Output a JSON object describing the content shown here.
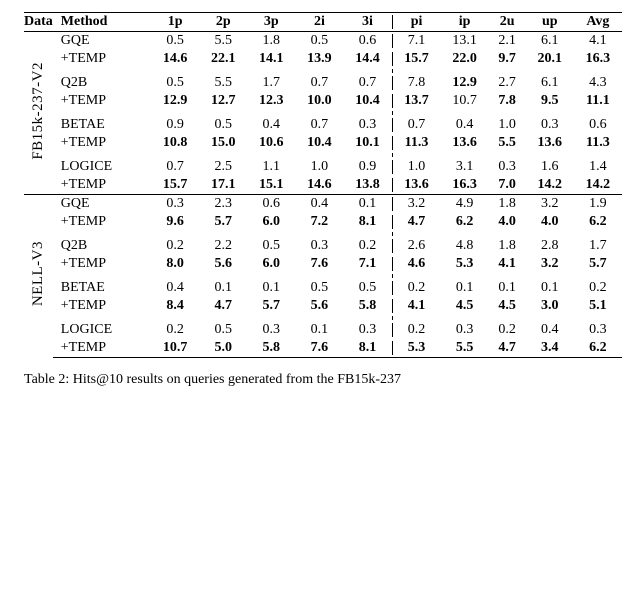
{
  "header": {
    "data": "Data",
    "method": "Method",
    "cols": [
      "1p",
      "2p",
      "3p",
      "2i",
      "3i",
      "pi",
      "ip",
      "2u",
      "up",
      "Avg"
    ]
  },
  "chart_data": {
    "type": "table",
    "title": "Hits@10 results comparison",
    "col_groups": [
      "left",
      "left",
      "left",
      "left",
      "left",
      "right",
      "right",
      "right",
      "right",
      "right"
    ],
    "datasets": [
      {
        "name": "FB15k-237-V2",
        "groups": [
          {
            "rows": [
              {
                "method": "GQE",
                "vals": [
                  "0.5",
                  "5.5",
                  "1.8",
                  "0.5",
                  "0.6",
                  "7.1",
                  "13.1",
                  "2.1",
                  "6.1",
                  "4.1"
                ],
                "bold_mask": [
                  0,
                  0,
                  0,
                  0,
                  0,
                  0,
                  0,
                  0,
                  0,
                  0
                ]
              },
              {
                "method": "+TEMP",
                "vals": [
                  "14.6",
                  "22.1",
                  "14.1",
                  "13.9",
                  "14.4",
                  "15.7",
                  "22.0",
                  "9.7",
                  "20.1",
                  "16.3"
                ],
                "bold_mask": [
                  1,
                  1,
                  1,
                  1,
                  1,
                  1,
                  1,
                  1,
                  1,
                  1
                ]
              }
            ]
          },
          {
            "rows": [
              {
                "method": "Q2B",
                "vals": [
                  "0.5",
                  "5.5",
                  "1.7",
                  "0.7",
                  "0.7",
                  "7.8",
                  "12.9",
                  "2.7",
                  "6.1",
                  "4.3"
                ],
                "bold_mask": [
                  0,
                  0,
                  0,
                  0,
                  0,
                  0,
                  1,
                  0,
                  0,
                  0
                ]
              },
              {
                "method": "+TEMP",
                "vals": [
                  "12.9",
                  "12.7",
                  "12.3",
                  "10.0",
                  "10.4",
                  "13.7",
                  "10.7",
                  "7.8",
                  "9.5",
                  "11.1"
                ],
                "bold_mask": [
                  1,
                  1,
                  1,
                  1,
                  1,
                  1,
                  0,
                  1,
                  1,
                  1
                ]
              }
            ]
          },
          {
            "rows": [
              {
                "method": "BETAE",
                "vals": [
                  "0.9",
                  "0.5",
                  "0.4",
                  "0.7",
                  "0.3",
                  "0.7",
                  "0.4",
                  "1.0",
                  "0.3",
                  "0.6"
                ],
                "bold_mask": [
                  0,
                  0,
                  0,
                  0,
                  0,
                  0,
                  0,
                  0,
                  0,
                  0
                ]
              },
              {
                "method": "+TEMP",
                "vals": [
                  "10.8",
                  "15.0",
                  "10.6",
                  "10.4",
                  "10.1",
                  "11.3",
                  "13.6",
                  "5.5",
                  "13.6",
                  "11.3"
                ],
                "bold_mask": [
                  1,
                  1,
                  1,
                  1,
                  1,
                  1,
                  1,
                  1,
                  1,
                  1
                ]
              }
            ]
          },
          {
            "rows": [
              {
                "method": "LOGICE",
                "vals": [
                  "0.7",
                  "2.5",
                  "1.1",
                  "1.0",
                  "0.9",
                  "1.0",
                  "3.1",
                  "0.3",
                  "1.6",
                  "1.4"
                ],
                "bold_mask": [
                  0,
                  0,
                  0,
                  0,
                  0,
                  0,
                  0,
                  0,
                  0,
                  0
                ]
              },
              {
                "method": "+TEMP",
                "vals": [
                  "15.7",
                  "17.1",
                  "15.1",
                  "14.6",
                  "13.8",
                  "13.6",
                  "16.3",
                  "7.0",
                  "14.2",
                  "14.2"
                ],
                "bold_mask": [
                  1,
                  1,
                  1,
                  1,
                  1,
                  1,
                  1,
                  1,
                  1,
                  1
                ]
              }
            ]
          }
        ]
      },
      {
        "name": "NELL-V3",
        "groups": [
          {
            "rows": [
              {
                "method": "GQE",
                "vals": [
                  "0.3",
                  "2.3",
                  "0.6",
                  "0.4",
                  "0.1",
                  "3.2",
                  "4.9",
                  "1.8",
                  "3.2",
                  "1.9"
                ],
                "bold_mask": [
                  0,
                  0,
                  0,
                  0,
                  0,
                  0,
                  0,
                  0,
                  0,
                  0
                ]
              },
              {
                "method": "+TEMP",
                "vals": [
                  "9.6",
                  "5.7",
                  "6.0",
                  "7.2",
                  "8.1",
                  "4.7",
                  "6.2",
                  "4.0",
                  "4.0",
                  "6.2"
                ],
                "bold_mask": [
                  1,
                  1,
                  1,
                  1,
                  1,
                  1,
                  1,
                  1,
                  1,
                  1
                ]
              }
            ]
          },
          {
            "rows": [
              {
                "method": "Q2B",
                "vals": [
                  "0.2",
                  "2.2",
                  "0.5",
                  "0.3",
                  "0.2",
                  "2.6",
                  "4.8",
                  "1.8",
                  "2.8",
                  "1.7"
                ],
                "bold_mask": [
                  0,
                  0,
                  0,
                  0,
                  0,
                  0,
                  0,
                  0,
                  0,
                  0
                ]
              },
              {
                "method": "+TEMP",
                "vals": [
                  "8.0",
                  "5.6",
                  "6.0",
                  "7.6",
                  "7.1",
                  "4.6",
                  "5.3",
                  "4.1",
                  "3.2",
                  "5.7"
                ],
                "bold_mask": [
                  1,
                  1,
                  1,
                  1,
                  1,
                  1,
                  1,
                  1,
                  1,
                  1
                ]
              }
            ]
          },
          {
            "rows": [
              {
                "method": "BETAE",
                "vals": [
                  "0.4",
                  "0.1",
                  "0.1",
                  "0.5",
                  "0.5",
                  "0.2",
                  "0.1",
                  "0.1",
                  "0.1",
                  "0.2"
                ],
                "bold_mask": [
                  0,
                  0,
                  0,
                  0,
                  0,
                  0,
                  0,
                  0,
                  0,
                  0
                ]
              },
              {
                "method": "+TEMP",
                "vals": [
                  "8.4",
                  "4.7",
                  "5.7",
                  "5.6",
                  "5.8",
                  "4.1",
                  "4.5",
                  "4.5",
                  "3.0",
                  "5.1"
                ],
                "bold_mask": [
                  1,
                  1,
                  1,
                  1,
                  1,
                  1,
                  1,
                  1,
                  1,
                  1
                ]
              }
            ]
          },
          {
            "rows": [
              {
                "method": "LOGICE",
                "vals": [
                  "0.2",
                  "0.5",
                  "0.3",
                  "0.1",
                  "0.3",
                  "0.2",
                  "0.3",
                  "0.2",
                  "0.4",
                  "0.3"
                ],
                "bold_mask": [
                  0,
                  0,
                  0,
                  0,
                  0,
                  0,
                  0,
                  0,
                  0,
                  0
                ]
              },
              {
                "method": "+TEMP",
                "vals": [
                  "10.7",
                  "5.0",
                  "5.8",
                  "7.6",
                  "8.1",
                  "5.3",
                  "5.5",
                  "4.7",
                  "3.4",
                  "6.2"
                ],
                "bold_mask": [
                  1,
                  1,
                  1,
                  1,
                  1,
                  1,
                  1,
                  1,
                  1,
                  1
                ]
              }
            ]
          }
        ]
      }
    ]
  },
  "caption_prefix": "Table 2: Hits@10 results on queries generated from the FB15k-237"
}
